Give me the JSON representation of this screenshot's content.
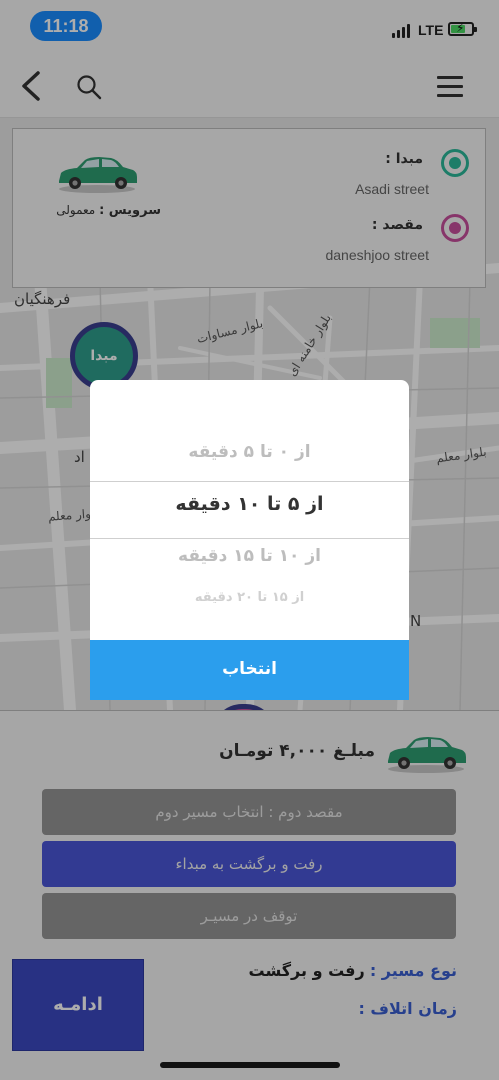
{
  "status_bar": {
    "time": "11:18",
    "network": "LTE"
  },
  "route_card": {
    "origin_label": "مبدا :",
    "origin_value": "Asadi street",
    "destination_label": "مقصد :",
    "destination_value": "daneshjoo street",
    "service_label": "سرویس :",
    "service_value": "معمولی"
  },
  "map": {
    "origin_pin_label": "مبدا",
    "labels": {
      "farhangian": "فرهنگیان",
      "masavat": "بلوار مساوات",
      "khamenei": "بلوار خامنه ای",
      "moallem_right": "بلوار معلم",
      "moallem_left": "بلوار معلم",
      "ad": "اد",
      "n": "N"
    }
  },
  "picker": {
    "options": [
      "از ۰ تا ۵ دقیقه",
      "از ۵ تا ۱۰ دقیقه",
      "از ۱۰ تا ۱۵ دقیقه",
      "از ۱۵ تا ۲۰ دقیقه"
    ],
    "selected_index": 1,
    "button_label": "انتخاب"
  },
  "sheet": {
    "price": "مبلـغ ۴,۰۰۰ تومـان",
    "second_destination": "مقصد دوم : انتخاب مسیر دوم",
    "round_trip": "رفت و برگشت به مبداء",
    "stop_on_route": "توقف در مسیـر",
    "route_type_label": "نوع مسیر :",
    "route_type_value": "رفت و برگشت",
    "waste_time_label": "زمان اتلاف :",
    "continue_label": "ادامـه"
  },
  "colors": {
    "accent_blue": "#2b9eed",
    "indigo": "#4a56d8",
    "origin_green": "#2cb89a",
    "destination_pink": "#c84e9c",
    "label_blue": "#3a5fd0"
  },
  "icons": {
    "back": "chevron-left-icon",
    "search": "search-icon",
    "menu": "hamburger-menu-icon",
    "car": "taxi-car-icon",
    "battery": "battery-charging-icon",
    "signal": "cellular-signal-icon"
  }
}
